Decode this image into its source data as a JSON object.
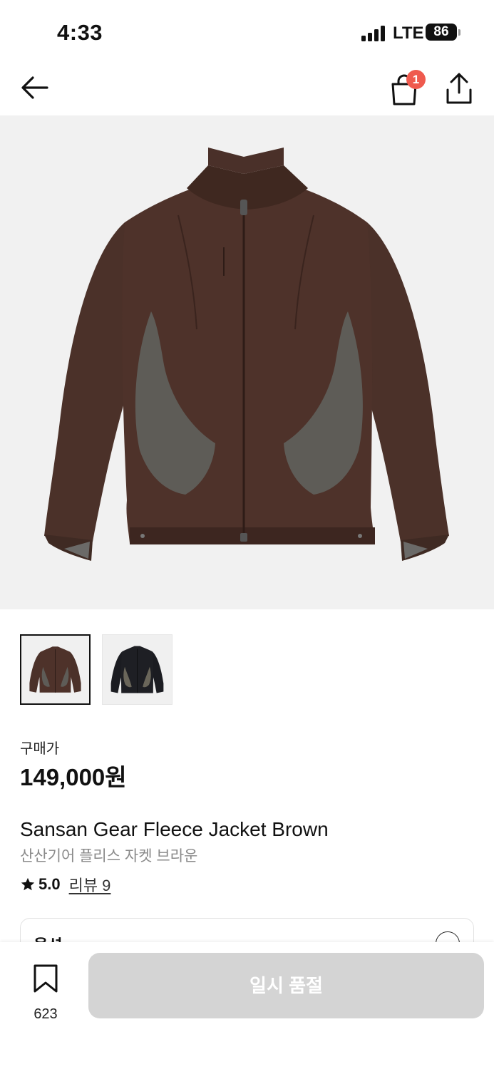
{
  "status_bar": {
    "time": "4:33",
    "network": "LTE",
    "battery": "86"
  },
  "nav": {
    "back_icon": "arrow-left-icon",
    "cart_icon": "shopping-bag-icon",
    "cart_badge": "1",
    "share_icon": "share-icon"
  },
  "gallery": {
    "main_image": "brown fleece jacket",
    "thumbnails": [
      "brown fleece jacket",
      "black fleece jacket"
    ],
    "selected_index": 0
  },
  "product": {
    "price_label": "구매가",
    "price": "149,000원",
    "title_en": "Sansan Gear Fleece Jacket Brown",
    "title_ko": "산산기어 플리스 자켓 브라운",
    "rating": "5.0",
    "review_link": "리뷰 9"
  },
  "option_card": {
    "title": "옵션"
  },
  "bottom_bar": {
    "bookmark_count": "623",
    "soldout_label": "일시 품절"
  },
  "colors": {
    "badge": "#ef5a4e",
    "soldout_button_bg": "#d4d4d4",
    "image_bg": "#f1f1f1",
    "jacket_brown": "#4a3029",
    "panel_grey": "#5b5a55"
  }
}
